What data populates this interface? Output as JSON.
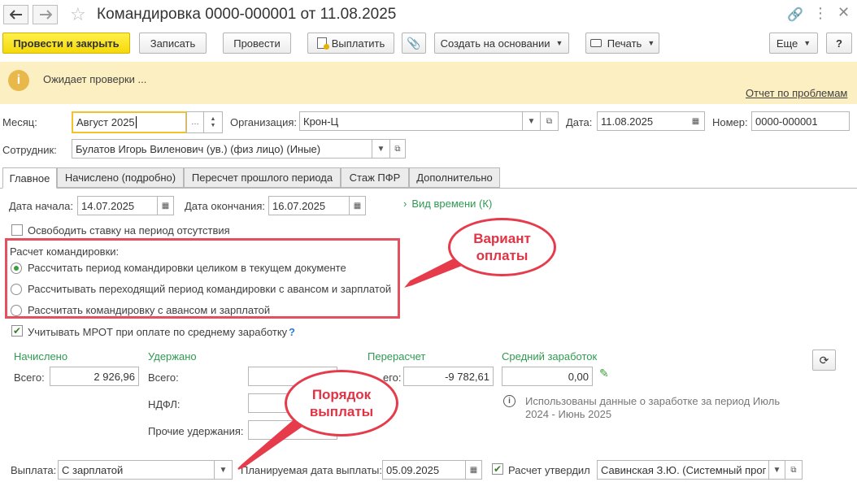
{
  "window": {
    "title": "Командировка 0000-000001 от 11.08.2025"
  },
  "toolbar": {
    "post_close": "Провести и закрыть",
    "save": "Записать",
    "post": "Провести",
    "pay": "Выплатить",
    "create_based": "Создать на основании",
    "print": "Печать",
    "more": "Еще",
    "help": "?"
  },
  "banner": {
    "message": "Ожидает проверки ...",
    "problems_link": "Отчет по проблемам"
  },
  "header": {
    "month_label": "Месяц:",
    "month_value": "Август 2025",
    "org_label": "Организация:",
    "org_value": "Крон-Ц",
    "date_label": "Дата:",
    "date_value": "11.08.2025",
    "number_label": "Номер:",
    "number_value": "0000-000001",
    "employee_label": "Сотрудник:",
    "employee_value": "Булатов Игорь Виленович (ув.) (физ лицо) (Иные)"
  },
  "tabs": [
    {
      "label": "Главное"
    },
    {
      "label": "Начислено (подробно)"
    },
    {
      "label": "Пересчет прошлого периода"
    },
    {
      "label": "Стаж ПФР"
    },
    {
      "label": "Дополнительно"
    }
  ],
  "main": {
    "start_label": "Дата начала:",
    "start_value": "14.07.2025",
    "end_label": "Дата окончания:",
    "end_value": "16.07.2025",
    "time_kind": "Вид времени (К)",
    "free_rate": "Освободить ставку на период отсутствия",
    "calc_title": "Расчет командировки:",
    "radio_1": "Рассчитать период командировки целиком в текущем документе",
    "radio_2": "Рассчитывать переходящий период командировки с авансом и зарплатой",
    "radio_3": "Рассчитать командировку с авансом и зарплатой",
    "mrot": "Учитывать МРОТ при оплате по среднему заработку",
    "mrot_help": "?",
    "accrued_title": "Начислено",
    "accrued_total_label": "Всего:",
    "accrued_total_value": "2 926,96",
    "withheld_title": "Удержано",
    "withheld_total_label": "Всего:",
    "ndfl_label": "НДФЛ:",
    "other_label": "Прочие удержания:",
    "recalc_title": "Перерасчет",
    "recalc_total_label_visible": "его:",
    "recalc_value": "-9 782,61",
    "avg_title": "Средний заработок",
    "avg_value": "0,00",
    "avg_note_line1": "Использованы данные о заработке за период Июль",
    "avg_note_line2": "2024 - Июнь 2025"
  },
  "footer": {
    "payout_label": "Выплата:",
    "payout_value": "С зарплатой",
    "planned_label": "Планируемая дата выплаты:",
    "planned_value": "05.09.2025",
    "approved_label": "Расчет утвердил",
    "approved_value": "Савинская З.Ю. (Системный прог"
  },
  "annotations": {
    "bubble_1_line1": "Вариант",
    "bubble_1_line2": "оплаты",
    "bubble_2_line1": "Порядок",
    "bubble_2_line2": "выплаты"
  }
}
